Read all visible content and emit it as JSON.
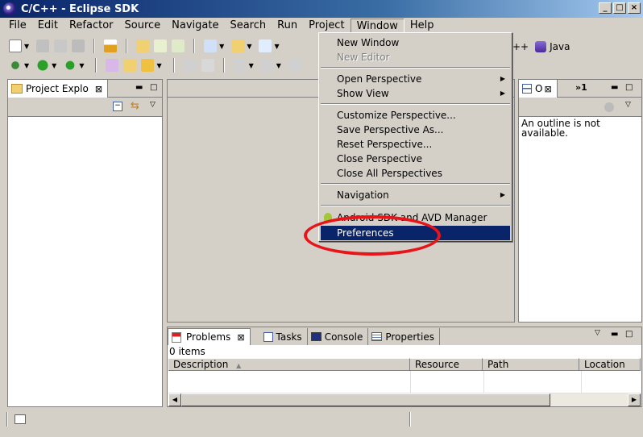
{
  "window": {
    "title": "C/C++ - Eclipse SDK"
  },
  "menubar": [
    "File",
    "Edit",
    "Refactor",
    "Source",
    "Navigate",
    "Search",
    "Run",
    "Project",
    "Window",
    "Help"
  ],
  "perspective": {
    "cpp_label": "++",
    "java_label": "Java"
  },
  "project_explorer": {
    "title": "Project Explo"
  },
  "outline": {
    "title": "O",
    "overflow": "»1",
    "message": "An outline is not available."
  },
  "window_menu": {
    "items": [
      {
        "label": "New Window",
        "disabled": false,
        "submenu": false
      },
      {
        "label": "New Editor",
        "disabled": true,
        "submenu": false
      },
      {
        "label": "Open Perspective",
        "disabled": false,
        "submenu": true
      },
      {
        "label": "Show View",
        "disabled": false,
        "submenu": true
      },
      {
        "label": "Customize Perspective...",
        "disabled": false,
        "submenu": false
      },
      {
        "label": "Save Perspective As...",
        "disabled": false,
        "submenu": false
      },
      {
        "label": "Reset Perspective...",
        "disabled": false,
        "submenu": false
      },
      {
        "label": "Close Perspective",
        "disabled": false,
        "submenu": false
      },
      {
        "label": "Close All Perspectives",
        "disabled": false,
        "submenu": false
      },
      {
        "label": "Navigation",
        "disabled": false,
        "submenu": true
      },
      {
        "label": "Android SDK and AVD Manager",
        "disabled": false,
        "submenu": false
      },
      {
        "label": "Preferences",
        "disabled": false,
        "submenu": false,
        "selected": true
      }
    ]
  },
  "problems_view": {
    "tabs": [
      "Problems",
      "Tasks",
      "Console",
      "Properties"
    ],
    "count": "0 items",
    "columns": [
      "Description",
      "Resource",
      "Path",
      "Location"
    ]
  },
  "colors": {
    "title_start": "#0a246a",
    "selection": "#0a246a",
    "highlight_ellipse": "#e8141a",
    "chrome": "#d4d0c8"
  }
}
